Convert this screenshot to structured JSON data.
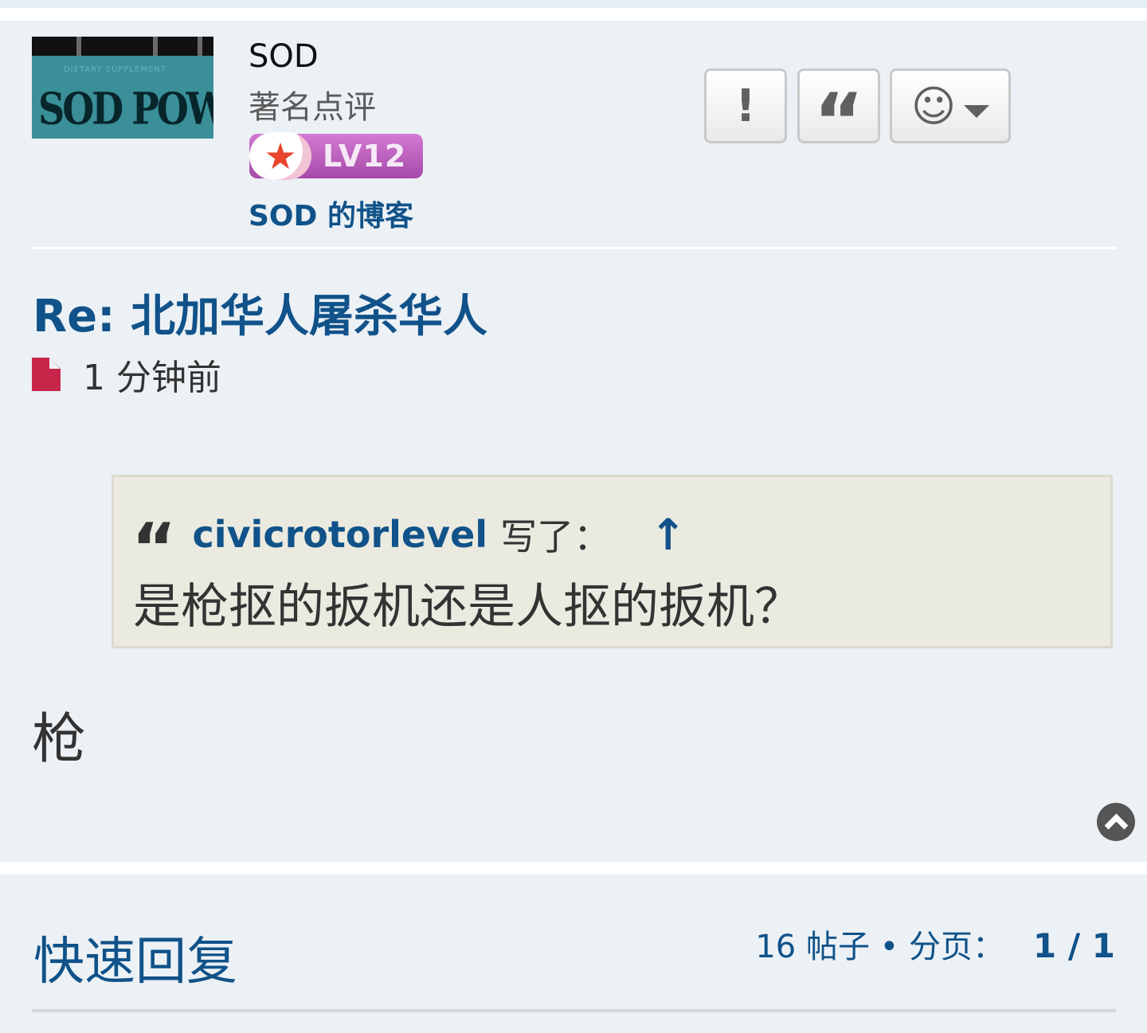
{
  "user": {
    "avatar_caption": "SOD POWER",
    "avatar_subcaption": "DIETARY SUPPLEMENT",
    "username": "SOD",
    "rank": "著名点评",
    "level": "LV12",
    "blog_link": "SOD 的博客"
  },
  "actions": {
    "report_glyph": "!",
    "quote_glyph": "“",
    "more_glyph": "☺"
  },
  "post": {
    "title": "Re: 北加华人屠杀华人",
    "time": "1 分钟前",
    "quote": {
      "icon_glyph": "“",
      "author": "civicrotorlevel",
      "wrote": "写了：",
      "up_glyph": "↑",
      "text": "是枪抠的扳机还是人抠的扳机？"
    },
    "body": "枪"
  },
  "footer": {
    "quick_reply": "快速回复",
    "post_count": "16 帖子 • 分页：",
    "page": "1 / 1"
  },
  "colors": {
    "link": "#105289",
    "post_bg": "#ecf1f5",
    "quote_bg": "#ebeae0",
    "file_icon": "#c8254a"
  }
}
